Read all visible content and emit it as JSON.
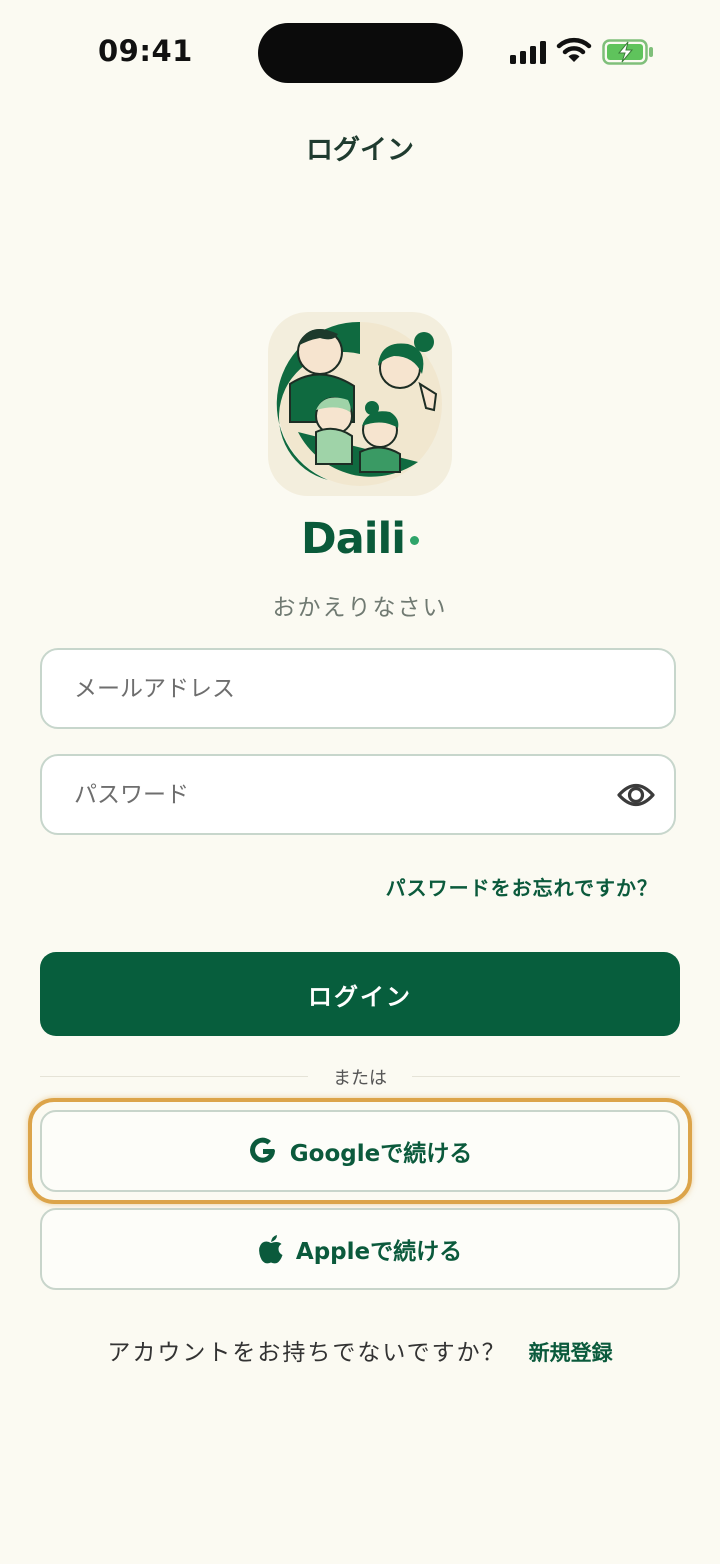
{
  "status_bar": {
    "time": "09:41"
  },
  "header": {
    "title": "ログイン"
  },
  "brand": {
    "name": "Daili",
    "tagline": "おかえりなさい"
  },
  "form": {
    "email_placeholder": "メールアドレス",
    "password_placeholder": "パスワード",
    "forgot_password": "パスワードをお忘れですか？",
    "login_button": "ログイン"
  },
  "divider_text": "または",
  "sso": {
    "google_label": "Googleで続ける",
    "apple_label": "Appleで続ける"
  },
  "signup": {
    "question": "アカウントをお持ちでないですか？",
    "link": "新規登録"
  },
  "colors": {
    "background": "#fbfaf2",
    "primary": "#075e3d",
    "highlight": "#dca44a",
    "accent_dot": "#2fa46a"
  },
  "icons": [
    "cellular-signal-icon",
    "wifi-icon",
    "battery-charging-icon",
    "eye-icon",
    "google-icon",
    "apple-icon",
    "family-logo-icon"
  ]
}
